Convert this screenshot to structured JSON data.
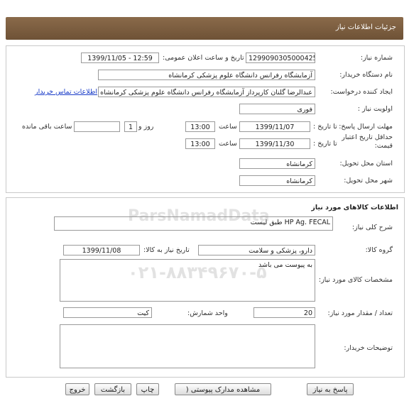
{
  "header": {
    "title": "جزئیات اطلاعات نیاز"
  },
  "need_info": {
    "need_number_label": "شماره نیاز:",
    "need_number": "1299090305000425",
    "announce_label": "تاریخ و ساعت اعلان عمومی:",
    "announce_value": "1399/11/05 - 12:59",
    "buyer_org_label": "نام دستگاه خریدار:",
    "buyer_org": "آزمایشگاه رفرانس دانشگاه علوم پزشکی کرمانشاه",
    "creator_label": "ایجاد کننده درخواست:",
    "creator": "عبدالرضا گلنان کارپرداز آزمایشگاه رفرانس دانشگاه علوم پزشکی کرمانشاه",
    "contact_link": "اطلاعات تماس خریدار",
    "priority_label": "اولویت نیاز :",
    "priority": "فوری",
    "deadline_label": "مهلت ارسال پاسخ:",
    "until_date_label": "تا تاریخ :",
    "deadline_date": "1399/11/07",
    "time_label": "ساعت",
    "deadline_time": "13:00",
    "days_value": "1",
    "days_label": "روز و",
    "remaining_label": "ساعت باقی مانده",
    "price_valid_label": "حداقل تاریخ اعتبار قیمت:",
    "price_valid_date": "1399/11/30",
    "price_valid_time": "13:00",
    "province_label": "استان محل تحویل:",
    "province": "کرمانشاه",
    "city_label": "شهر محل تحویل:",
    "city": "کرمانشاه"
  },
  "goods": {
    "section_title": "اطلاعات کالاهای مورد نیاز",
    "general_desc_label": "شرح کلی نیاز:",
    "general_desc": "HP Ag. FECAL طبق لیست",
    "group_label": "گروه کالا:",
    "group": "دارو، پزشکی و سلامت",
    "need_date_label": "تاریخ نیاز به کالا:",
    "need_date": "1399/11/08",
    "specs_label": "مشخصات کالای مورد نیاز:",
    "specs": "به پیوست می باشد",
    "qty_label": "تعداد / مقدار مورد نیاز:",
    "qty": "20",
    "unit_label": "واحد شمارش:",
    "unit": "کیت",
    "buyer_notes_label": "توضیحات خریدار:",
    "buyer_notes": ""
  },
  "buttons": {
    "reply": "پاسخ به نیاز",
    "view_docs": "مشاهده مدارک پیوستی (",
    "print": "چاپ",
    "back": "بازگشت",
    "exit": "خروج"
  },
  "watermark": {
    "brand": "ParsNamadData",
    "phone": "۰۲۱-۸۸۳۴۹۶۷۰-۵"
  }
}
